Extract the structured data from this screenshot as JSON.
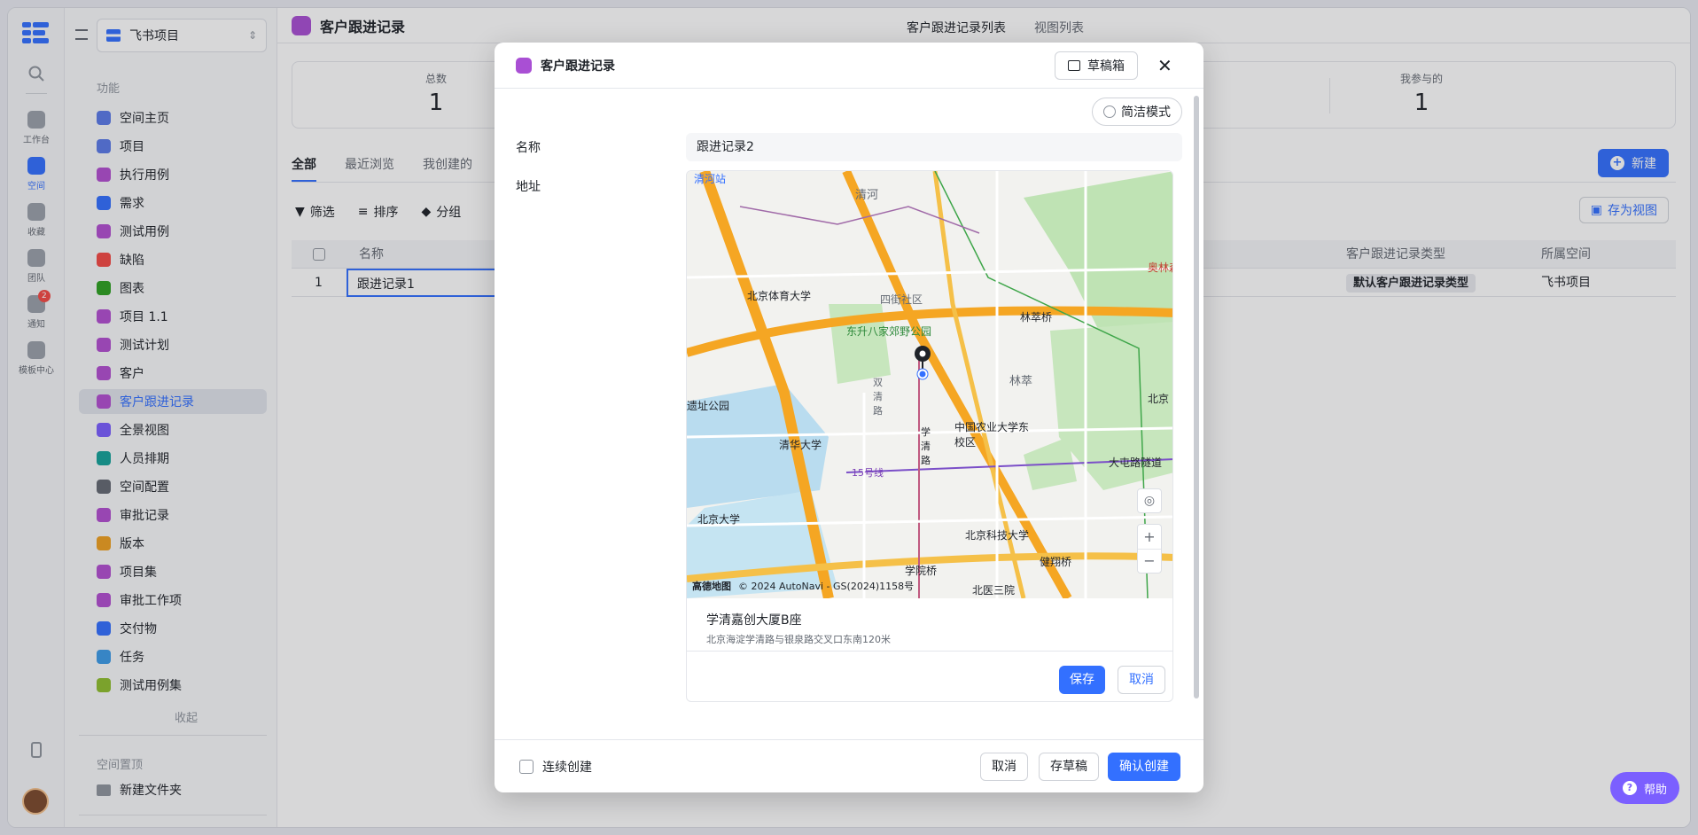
{
  "rail": {
    "items": [
      {
        "label": "工作台"
      },
      {
        "label": "空间"
      },
      {
        "label": "收藏"
      },
      {
        "label": "团队"
      },
      {
        "label": "通知",
        "badge": "2"
      },
      {
        "label": "模板中心"
      }
    ]
  },
  "sidebar": {
    "project_name": "飞书项目",
    "section_title": "功能",
    "items": [
      {
        "label": "空间主页",
        "color": "#5b7be8"
      },
      {
        "label": "项目",
        "color": "#5b7be8"
      },
      {
        "label": "执行用例",
        "color": "#b34fd1"
      },
      {
        "label": "需求",
        "color": "#3370ff"
      },
      {
        "label": "测试用例",
        "color": "#b34fd1"
      },
      {
        "label": "缺陷",
        "color": "#f54a45"
      },
      {
        "label": "图表",
        "color": "#2ea121"
      },
      {
        "label": "项目 1.1",
        "color": "#b34fd1"
      },
      {
        "label": "测试计划",
        "color": "#b34fd1"
      },
      {
        "label": "客户",
        "color": "#b34fd1"
      },
      {
        "label": "客户跟进记录",
        "color": "#b34fd1",
        "active": true
      },
      {
        "label": "全景视图",
        "color": "#7b5fff"
      },
      {
        "label": "人员排期",
        "color": "#14a39a"
      },
      {
        "label": "空间配置",
        "color": "#646a73"
      },
      {
        "label": "审批记录",
        "color": "#b34fd1"
      },
      {
        "label": "版本",
        "color": "#f0a020"
      },
      {
        "label": "项目集",
        "color": "#b34fd1"
      },
      {
        "label": "审批工作项",
        "color": "#b34fd1"
      },
      {
        "label": "交付物",
        "color": "#3370ff"
      },
      {
        "label": "任务",
        "color": "#3c9be8"
      },
      {
        "label": "测试用例集",
        "color": "#8fbf2e"
      }
    ],
    "collapse_label": "收起",
    "pin_title": "空间置顶",
    "folder_label": "新建文件夹"
  },
  "main": {
    "title": "客户跟进记录",
    "top_tabs": [
      "客户跟进记录列表",
      "视图列表"
    ],
    "stats": [
      {
        "label": "总数",
        "value": "1"
      },
      {
        "label": "我参与的",
        "value": "1"
      }
    ],
    "tabs": [
      "全部",
      "最近浏览",
      "我创建的"
    ],
    "new_button": "新建",
    "toolbar": {
      "filter": "筛选",
      "sort": "排序",
      "group": "分组"
    },
    "save_view": "存为视图",
    "grid": {
      "headers": [
        "名称",
        "客户跟进记录类型",
        "所属空间"
      ],
      "rows": [
        {
          "index": "1",
          "name": "跟进记录1",
          "type": "默认客户跟进记录类型",
          "space": "飞书项目"
        }
      ]
    }
  },
  "modal": {
    "title": "客户跟进记录",
    "draft_button": "草稿箱",
    "simple_mode": "简洁模式",
    "name_label": "名称",
    "name_value": "跟进记录2",
    "address_label": "地址",
    "map": {
      "labels": [
        "清河站",
        "清河",
        "北京体育大学",
        "四街社区",
        "东升八家郊野公园",
        "林萃桥",
        "奥林森林",
        "林萃",
        "北京",
        "双清路",
        "遗址公园",
        "清华大学",
        "中国农业大学东校区",
        "学清路",
        "15号线",
        "大屯路隧道",
        "北京大学",
        "北京科技大学",
        "健翔桥",
        "学院桥",
        "北医三院"
      ],
      "attribution_brand": "高德地图",
      "attribution_text": "© 2024 AutoNavi - GS(2024)1158号"
    },
    "address_name": "学清嘉创大厦B座",
    "address_detail": "北京海淀学清路与银泉路交叉口东南120米",
    "map_save": "保存",
    "map_cancel": "取消",
    "continuous_create": "连续创建",
    "footer_cancel": "取消",
    "footer_draft": "存草稿",
    "footer_confirm": "确认创建"
  },
  "help": "帮助"
}
